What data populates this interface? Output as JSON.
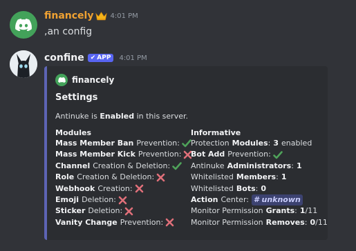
{
  "messages": [
    {
      "username": "financely",
      "username_color": "#f0a232",
      "badge_icon": "crown-icon",
      "time": "4:01 PM",
      "content": ",an config"
    },
    {
      "username": "confine",
      "username_color": "#f2f3f5",
      "app_badge": "APP",
      "time": "4:01 PM",
      "embed": {
        "author": "financely",
        "title": "Settings",
        "description": {
          "pre": "Antinuke is",
          "bold": "Enabled",
          "post": "in this server."
        },
        "modules_title": "Modules",
        "modules": [
          {
            "bold": "Mass Member Ban",
            "rest": "Prevention:",
            "status": "check"
          },
          {
            "bold": "Mass Member Kick",
            "rest": "Prevention:",
            "status": "cross"
          },
          {
            "bold": "Channel",
            "rest": "Creation & Deletion:",
            "status": "check"
          },
          {
            "bold": "Role",
            "rest": "Creation & Deletion:",
            "status": "cross"
          },
          {
            "bold": "Webhook",
            "rest": "Creation:",
            "status": "cross"
          },
          {
            "bold": "Emoji",
            "rest": "Deletion:",
            "status": "cross"
          },
          {
            "bold": "Sticker",
            "rest": "Deletion:",
            "status": "cross"
          },
          {
            "bold": "Vanity Change",
            "rest": "Prevention:",
            "status": "cross"
          }
        ],
        "informative_title": "Informative",
        "informative": [
          {
            "pre": "Protection",
            "bold": "Modules",
            "post": ":",
            "value_bold": "3",
            "value_rest": "enabled"
          },
          {
            "pre": "",
            "bold": "Bot Add",
            "post": "Prevention:",
            "status": "check"
          },
          {
            "pre": "Antinuke",
            "bold": "Administrators",
            "post": ":",
            "value_bold": "1"
          },
          {
            "pre": "Whitelisted",
            "bold": "Members",
            "post": ":",
            "value_bold": "1"
          },
          {
            "pre": "Whitelisted",
            "bold": "Bots",
            "post": ":",
            "value_bold": "0"
          },
          {
            "pre": "",
            "bold": "Action",
            "post": "Center:",
            "channel": "# unknown"
          },
          {
            "pre": "Monitor Permission",
            "bold": "Grants",
            "post": ":",
            "value_bold": "1",
            "value_rest": "/11"
          },
          {
            "pre": "Monitor Permission",
            "bold": "Removes",
            "post": ":",
            "value_bold": "0",
            "value_rest": "/11"
          }
        ]
      }
    }
  ],
  "colors": {
    "check": "#4fa35a",
    "cross": "#e0707a",
    "embed_border": "#5d64b4"
  }
}
